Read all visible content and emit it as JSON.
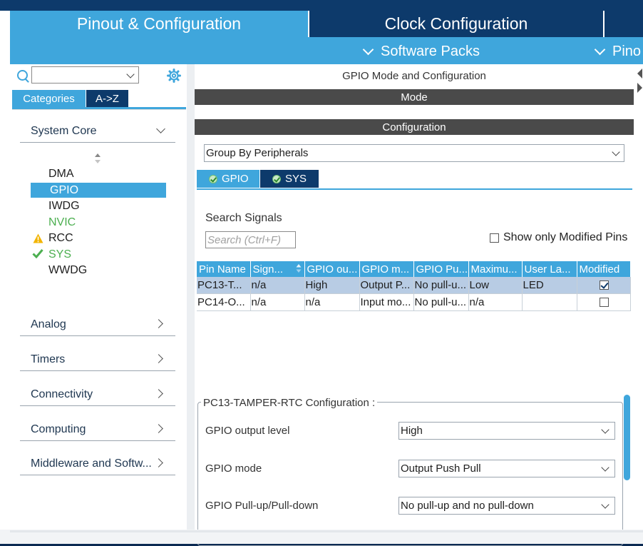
{
  "tabs": {
    "pinout": "Pinout & Configuration",
    "clock": "Clock Configuration"
  },
  "subbar": {
    "software_packs": "Software Packs",
    "pinout": "Pino"
  },
  "left": {
    "categories_tab": "Categories",
    "az_tab": "A->Z",
    "system_core": "System Core",
    "peripherals": [
      {
        "label": "DMA",
        "status": "none"
      },
      {
        "label": "GPIO",
        "status": "selected"
      },
      {
        "label": "IWDG",
        "status": "none"
      },
      {
        "label": "NVIC",
        "status": "configured"
      },
      {
        "label": "RCC",
        "status": "warning"
      },
      {
        "label": "SYS",
        "status": "ok"
      },
      {
        "label": "WWDG",
        "status": "none"
      }
    ],
    "sections": [
      "Analog",
      "Timers",
      "Connectivity",
      "Computing",
      "Middleware and Softw..."
    ]
  },
  "right": {
    "title": "GPIO Mode and Configuration",
    "mode_bar": "Mode",
    "config_bar": "Configuration",
    "group_by": "Group By Peripherals",
    "ptabs": [
      "GPIO",
      "SYS"
    ],
    "search_label": "Search Signals",
    "search_placeholder": "Search (Ctrl+F)",
    "show_modified": "Show only Modified Pins",
    "table": {
      "headers": [
        "Pin Name",
        "Sign...",
        "GPIO ou...",
        "GPIO m...",
        "GPIO Pu...",
        "Maximu...",
        "User La...",
        "Modified"
      ],
      "rows": [
        {
          "cells": [
            "PC13-T...",
            "n/a",
            "High",
            "Output P...",
            "No pull-u...",
            "Low",
            "LED"
          ],
          "modified": true
        },
        {
          "cells": [
            "PC14-O...",
            "n/a",
            "n/a",
            "Input mo...",
            "No pull-u...",
            "n/a",
            ""
          ],
          "modified": false
        }
      ]
    },
    "cfg_title": "PC13-TAMPER-RTC Configuration :",
    "cfg": [
      {
        "label": "GPIO output level",
        "value": "High"
      },
      {
        "label": "GPIO mode",
        "value": "Output Push Pull"
      },
      {
        "label": "GPIO Pull-up/Pull-down",
        "value": "No pull-up and no pull-down"
      }
    ]
  },
  "colors": {
    "accent": "#3fa6dc",
    "navy": "#0d3a6b",
    "dark_bar": "#4a4a4a",
    "ok_green": "#4caf50",
    "warn_yellow": "#f2b400"
  }
}
